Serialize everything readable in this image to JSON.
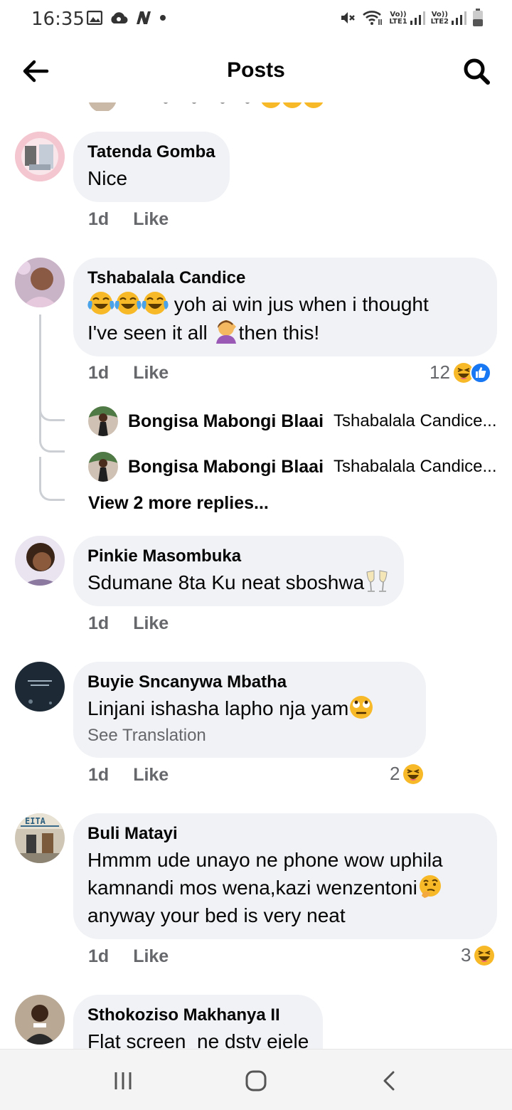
{
  "status_bar": {
    "time": "16:35",
    "sim1_label": "LTE1",
    "sim2_label": "LTE2",
    "volte_label": "Vo))"
  },
  "header": {
    "title": "Posts"
  },
  "comments": [
    {
      "name": "Tatenda Gomba",
      "text": "Nice",
      "time": "1d",
      "like_label": "Like"
    },
    {
      "name": "Tshabalala Candice",
      "text_line1": "yoh ai win jus when i thought",
      "text_line2_a": "I've seen it all",
      "text_line2_b": "then this!",
      "time": "1d",
      "like_label": "Like",
      "reaction_count": "12",
      "replies": [
        {
          "name": "Bongisa Mabongi Blaai",
          "text": "Tshabalala Candice..."
        },
        {
          "name": "Bongisa Mabongi Blaai",
          "text": "Tshabalala Candice..."
        }
      ],
      "view_more": "View 2 more replies..."
    },
    {
      "name": "Pinkie Masombuka",
      "text": "Sdumane 8ta Ku neat sboshwa",
      "time": "1d",
      "like_label": "Like"
    },
    {
      "name": "Buyie Sncanywa Mbatha",
      "text": "Linjani ishasha lapho nja yam",
      "see_translation": "See Translation",
      "time": "1d",
      "like_label": "Like",
      "reaction_count": "2"
    },
    {
      "name": "Buli Matayi",
      "text_line1": "Hmmm ude unayo ne phone wow uphila",
      "text_line2": "kamnandi mos wena,kazi wenzentoni",
      "text_line3": "anyway your bed is very neat",
      "avatar_text": "EITA",
      "time": "1d",
      "like_label": "Like",
      "reaction_count": "3"
    },
    {
      "name": "Sthokoziso Makhanya II",
      "text": "Flat screen  ne dstv ejele"
    }
  ],
  "colors": {
    "bubble": "#f0f2f5",
    "secondary_text": "#65676b",
    "like_blue": "#1877f2",
    "emoji_yellow": "#f7b928"
  },
  "icons": {
    "back": "arrow-left-icon",
    "search": "search-icon",
    "nav_recents": "recents-icon",
    "nav_home": "home-icon",
    "nav_back": "nav-back-icon"
  }
}
